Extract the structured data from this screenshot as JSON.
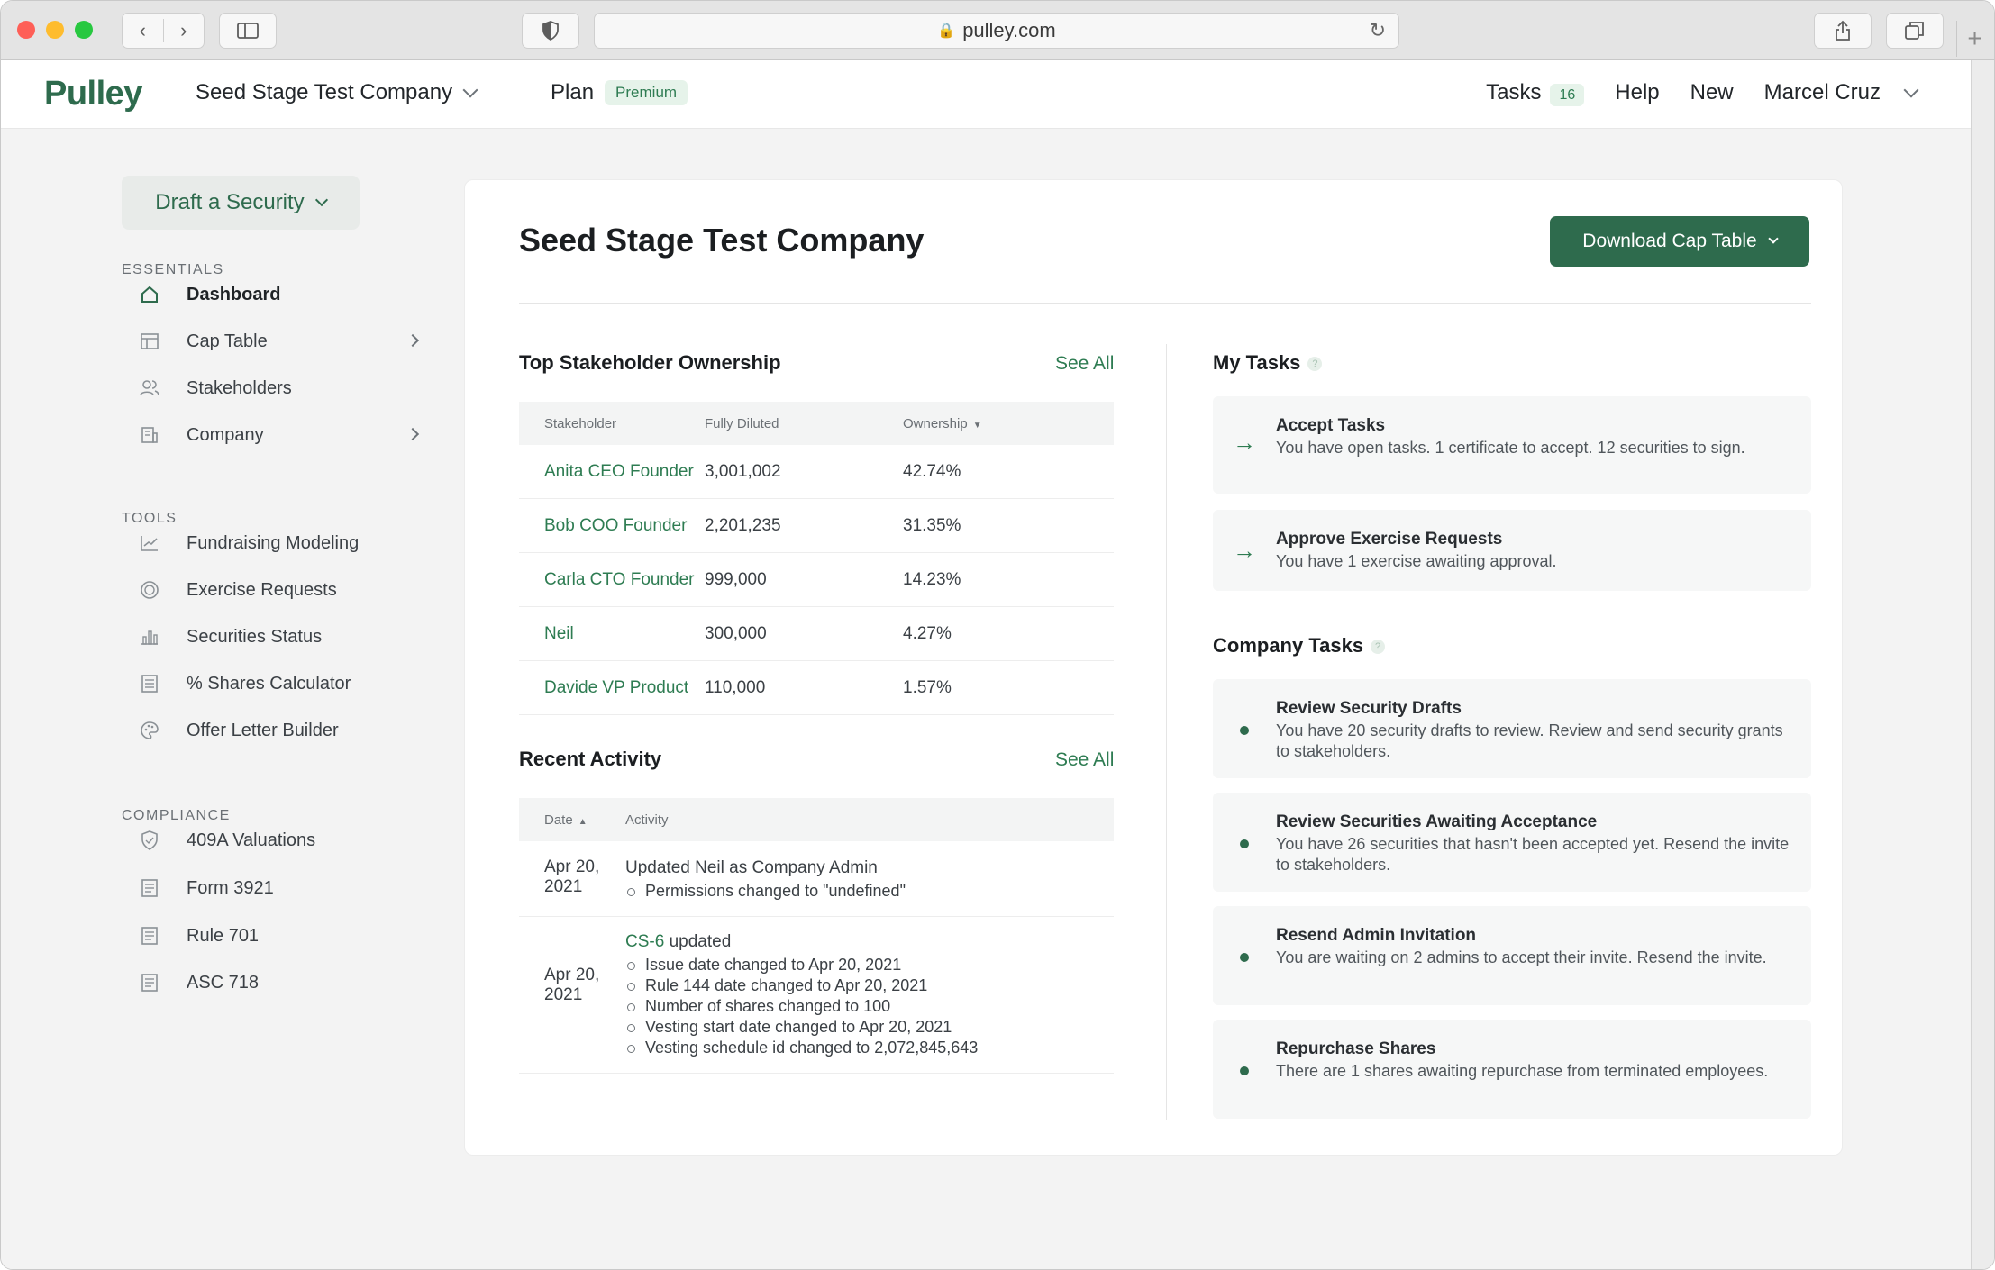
{
  "browser": {
    "url": "pulley.com"
  },
  "header": {
    "logo": "Pulley",
    "company": "Seed Stage Test Company",
    "plan_label": "Plan",
    "plan_badge": "Premium",
    "tasks_label": "Tasks",
    "tasks_count": "16",
    "help": "Help",
    "new": "New",
    "user": "Marcel Cruz"
  },
  "sidebar": {
    "draft_button": "Draft a Security",
    "essentials_label": "ESSENTIALS",
    "essentials": [
      {
        "label": "Dashboard",
        "icon": "home-icon"
      },
      {
        "label": "Cap Table",
        "icon": "table-icon"
      },
      {
        "label": "Stakeholders",
        "icon": "people-icon"
      },
      {
        "label": "Company",
        "icon": "building-icon"
      }
    ],
    "tools_label": "TOOLS",
    "tools": [
      {
        "label": "Fundraising Modeling",
        "icon": "line-chart-icon"
      },
      {
        "label": "Exercise Requests",
        "icon": "coin-icon"
      },
      {
        "label": "Securities Status",
        "icon": "bar-chart-icon"
      },
      {
        "label": "% Shares Calculator",
        "icon": "calculator-icon"
      },
      {
        "label": "Offer Letter Builder",
        "icon": "palette-icon"
      }
    ],
    "compliance_label": "COMPLIANCE",
    "compliance": [
      {
        "label": "409A Valuations",
        "icon": "shield-icon"
      },
      {
        "label": "Form 3921",
        "icon": "document-icon"
      },
      {
        "label": "Rule 701",
        "icon": "document-icon"
      },
      {
        "label": "ASC 718",
        "icon": "document-icon"
      }
    ]
  },
  "main": {
    "title": "Seed Stage Test Company",
    "download_button": "Download Cap Table",
    "ownership": {
      "heading": "Top Stakeholder Ownership",
      "see_all": "See All",
      "columns": [
        "Stakeholder",
        "Fully Diluted",
        "Ownership"
      ],
      "rows": [
        {
          "name": "Anita CEO Founder",
          "diluted": "3,001,002",
          "ownership": "42.74%"
        },
        {
          "name": "Bob COO Founder",
          "diluted": "2,201,235",
          "ownership": "31.35%"
        },
        {
          "name": "Carla CTO Founder",
          "diluted": "999,000",
          "ownership": "14.23%"
        },
        {
          "name": "Neil",
          "diluted": "300,000",
          "ownership": "4.27%"
        },
        {
          "name": "Davide VP Product",
          "diluted": "110,000",
          "ownership": "1.57%"
        }
      ]
    },
    "activity": {
      "heading": "Recent Activity",
      "see_all": "See All",
      "columns": [
        "Date",
        "Activity"
      ],
      "rows": [
        {
          "date_line1": "Apr 20,",
          "date_line2": "2021",
          "link": "",
          "text": "Updated Neil as Company Admin",
          "details": [
            "Permissions changed to \"undefined\""
          ]
        },
        {
          "date_line1": "Apr 20,",
          "date_line2": "2021",
          "link": "CS-6",
          "text": " updated",
          "details": [
            "Issue date changed to Apr 20, 2021",
            "Rule 144 date changed to Apr 20, 2021",
            "Number of shares changed to 100",
            "Vesting start date changed to Apr 20, 2021",
            "Vesting schedule id changed to 2,072,845,643"
          ]
        }
      ]
    },
    "my_tasks": {
      "heading": "My Tasks",
      "items": [
        {
          "title": "Accept Tasks",
          "desc": "You have open tasks. 1 certificate to accept. 12 securities to sign."
        },
        {
          "title": "Approve Exercise Requests",
          "desc": "You have 1 exercise awaiting approval."
        }
      ]
    },
    "company_tasks": {
      "heading": "Company Tasks",
      "items": [
        {
          "title": "Review Security Drafts",
          "desc": "You have 20 security drafts to review. Review and send security grants to stakeholders."
        },
        {
          "title": "Review Securities Awaiting Acceptance",
          "desc": "You have 26 securities that hasn't been accepted yet. Resend the invite to stakeholders."
        },
        {
          "title": "Resend Admin Invitation",
          "desc": "You are waiting on 2 admins to accept their invite. Resend the invite."
        },
        {
          "title": "Repurchase Shares",
          "desc": "There are 1 shares awaiting repurchase from terminated employees."
        }
      ]
    }
  }
}
